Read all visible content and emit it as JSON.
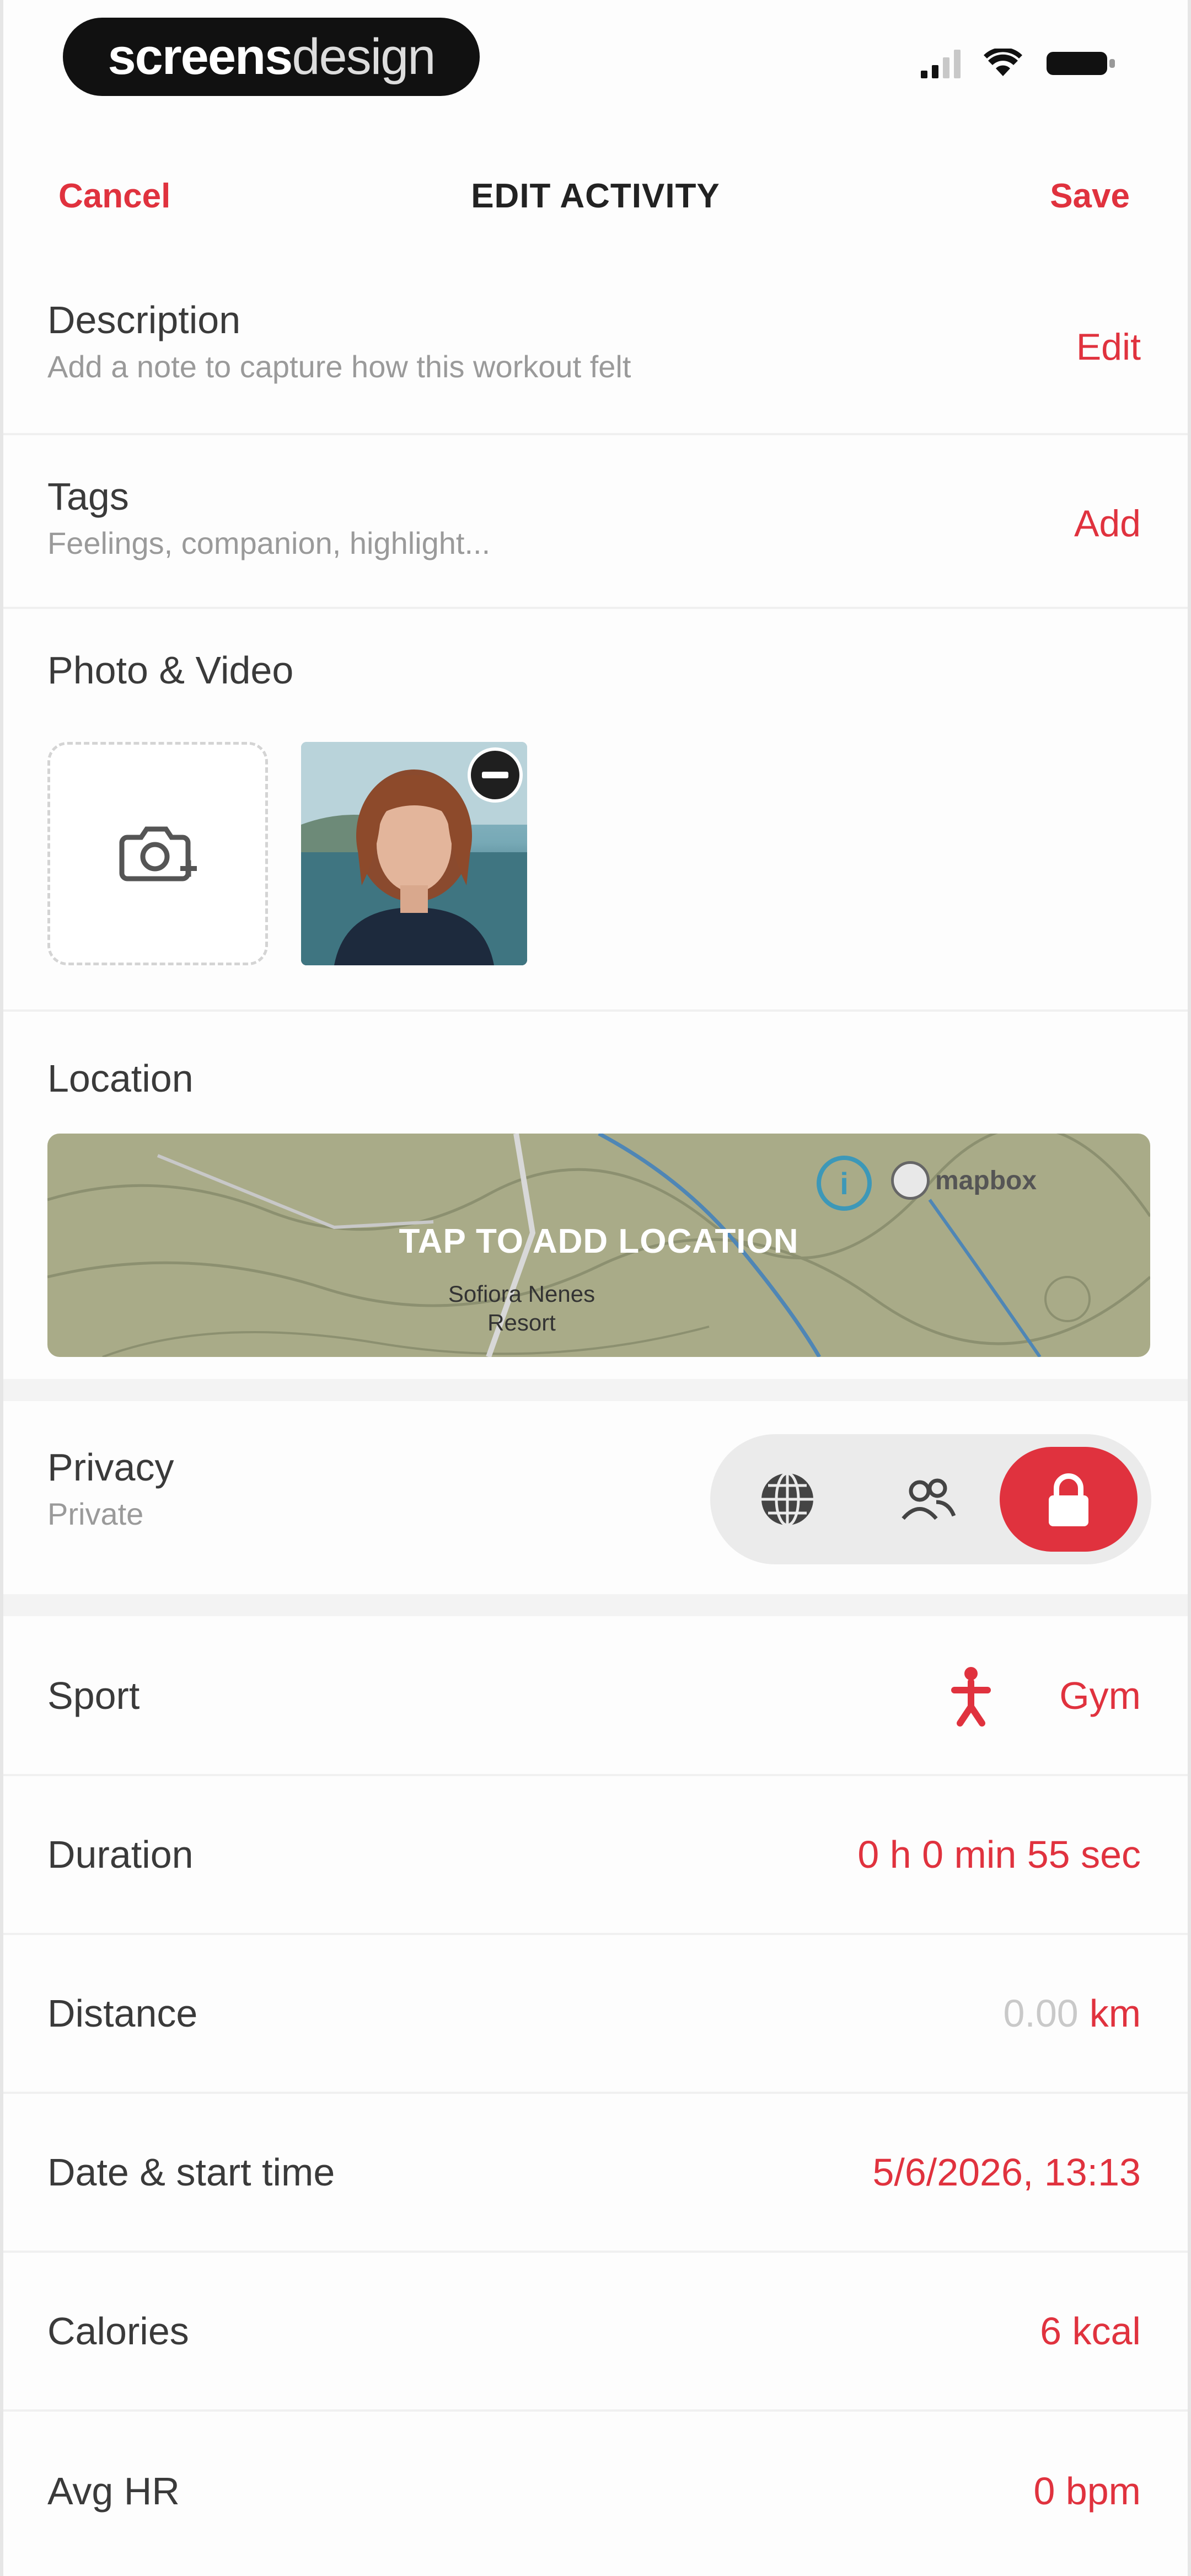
{
  "status_bar": {
    "brand_bold": "screens",
    "brand_light": "design"
  },
  "nav": {
    "cancel": "Cancel",
    "title": "EDIT ACTIVITY",
    "save": "Save"
  },
  "description": {
    "title": "Description",
    "subtitle": "Add a note to capture how this workout felt",
    "action": "Edit"
  },
  "tags": {
    "title": "Tags",
    "subtitle": "Feelings, companion, highlight...",
    "action": "Add"
  },
  "photo_video": {
    "title": "Photo & Video"
  },
  "location": {
    "title": "Location",
    "map_label": "TAP TO ADD LOCATION",
    "map_place": "Sofiora Nenes Resort",
    "map_attribution": "mapbox"
  },
  "privacy": {
    "title": "Privacy",
    "value": "Private",
    "options": [
      "public",
      "followers",
      "private"
    ],
    "selected": "private"
  },
  "details": {
    "sport_label": "Sport",
    "sport_value": "Gym",
    "duration_label": "Duration",
    "duration_value": "0 h 0 min 55 sec",
    "distance_label": "Distance",
    "distance_number": "0.00",
    "distance_unit": "km",
    "date_label": "Date & start time",
    "date_value": "5/6/2026, 13:13",
    "calories_label": "Calories",
    "calories_value": "6 kcal",
    "avg_hr_label": "Avg HR",
    "avg_hr_value": "0 bpm"
  },
  "colors": {
    "accent": "#e0323e",
    "text": "#3a3a3a",
    "subtext": "#9a9a9a"
  }
}
